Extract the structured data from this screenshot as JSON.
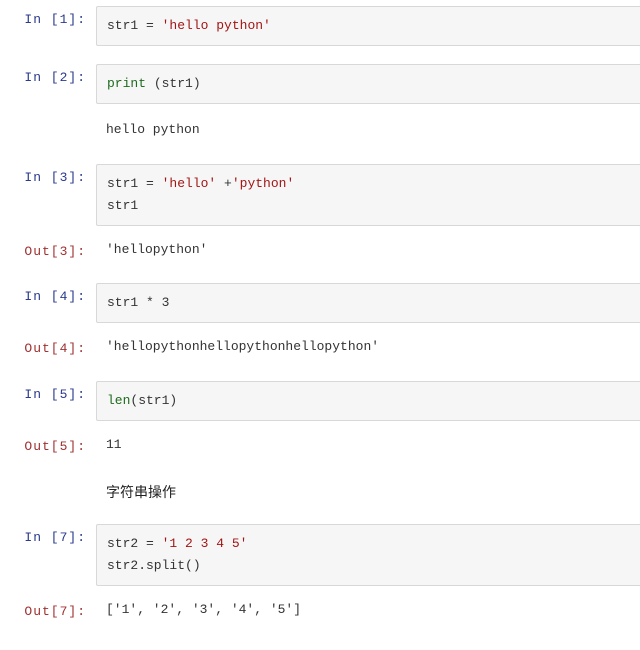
{
  "cells": [
    {
      "in_prompt": "In  [1]:",
      "code_tokens": [
        {
          "cls": "tok-var",
          "t": "str1 "
        },
        {
          "cls": "tok-var",
          "t": "= "
        },
        {
          "cls": "tok-str",
          "t": "'hello python'"
        }
      ]
    },
    {
      "in_prompt": "In  [2]:",
      "code_tokens": [
        {
          "cls": "tok-fn",
          "t": "print"
        },
        {
          "cls": "tok-var",
          "t": " (str1)"
        }
      ],
      "stdout": "hello python"
    },
    {
      "in_prompt": "In  [3]:",
      "code_tokens": [
        {
          "cls": "tok-var",
          "t": "str1 "
        },
        {
          "cls": "tok-var",
          "t": "= "
        },
        {
          "cls": "tok-str",
          "t": "'hello'"
        },
        {
          "cls": "tok-var",
          "t": " +"
        },
        {
          "cls": "tok-str",
          "t": "'python'"
        },
        {
          "cls": "",
          "t": "\n"
        },
        {
          "cls": "tok-var",
          "t": "str1"
        }
      ],
      "out_prompt": "Out[3]:",
      "out_text": "'hellopython'"
    },
    {
      "in_prompt": "In  [4]:",
      "code_tokens": [
        {
          "cls": "tok-var",
          "t": "str1 * 3"
        }
      ],
      "out_prompt": "Out[4]:",
      "out_text": "'hellopythonhellopythonhellopython'"
    },
    {
      "in_prompt": "In  [5]:",
      "code_tokens": [
        {
          "cls": "tok-fn",
          "t": "len"
        },
        {
          "cls": "tok-var",
          "t": "(str1)"
        }
      ],
      "out_prompt": "Out[5]:",
      "out_text": "11"
    },
    {
      "markdown": "字符串操作"
    },
    {
      "in_prompt": "In  [7]:",
      "code_tokens": [
        {
          "cls": "tok-var",
          "t": "str2 "
        },
        {
          "cls": "tok-var",
          "t": "= "
        },
        {
          "cls": "tok-str",
          "t": "'1 2 3 4 5'"
        },
        {
          "cls": "",
          "t": "\n"
        },
        {
          "cls": "tok-var",
          "t": "str2.split()"
        }
      ],
      "out_prompt": "Out[7]:",
      "out_text": "['1', '2', '3', '4', '5']"
    }
  ]
}
